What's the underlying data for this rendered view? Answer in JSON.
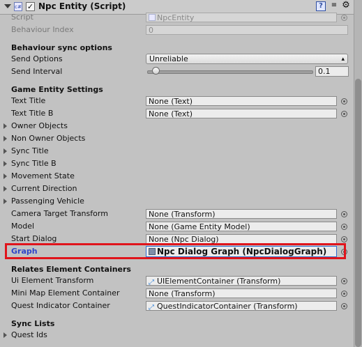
{
  "header": {
    "title": "Npc Entity (Script)",
    "enabled": "✓",
    "script_icon": "cs-script-icon",
    "icons": [
      "help-icon",
      "settings-sliders-icon",
      "gear-icon"
    ]
  },
  "fields": {
    "script": {
      "label": "Script",
      "value": "NpcEntity"
    },
    "behaviour_index": {
      "label": "Behaviour Index",
      "value": "0"
    }
  },
  "behaviour_sync": {
    "section": "Behaviour sync options",
    "send_options": {
      "label": "Send Options",
      "value": "Unreliable"
    },
    "send_interval": {
      "label": "Send Interval",
      "value": "0.1",
      "slider_fraction": 0.03
    }
  },
  "game_entity": {
    "section": "Game Entity Settings",
    "text_title": {
      "label": "Text Title",
      "value": "None (Text)"
    },
    "text_title_b": {
      "label": "Text Title B",
      "value": "None (Text)"
    },
    "foldouts": [
      "Owner Objects",
      "Non Owner Objects",
      "Sync Title",
      "Sync Title B",
      "Movement State",
      "Current Direction",
      "Passenging Vehicle"
    ],
    "camera_target": {
      "label": "Camera Target Transform",
      "value": "None (Transform)"
    },
    "model": {
      "label": "Model",
      "value": "None (Game Entity Model)"
    },
    "start_dialog": {
      "label": "Start Dialog",
      "value": "None (Npc Dialog)"
    },
    "graph": {
      "label": "Graph",
      "value": "Npc Dialog Graph (NpcDialogGraph)"
    }
  },
  "relates": {
    "section": "Relates Element Containers",
    "ui_element": {
      "label": "Ui Element Transform",
      "value": "UIElementContainer (Transform)"
    },
    "mini_map": {
      "label": "Mini Map Element Container",
      "value": "None (Transform)"
    },
    "quest_indicator": {
      "label": "Quest Indicator Container",
      "value": "QuestIndicatorContainer (Transform)"
    }
  },
  "sync_lists": {
    "section": "Sync Lists",
    "quest_ids": "Quest Ids"
  },
  "colors": {
    "highlight": "#e0141b",
    "graph_label": "#2f45c9"
  }
}
